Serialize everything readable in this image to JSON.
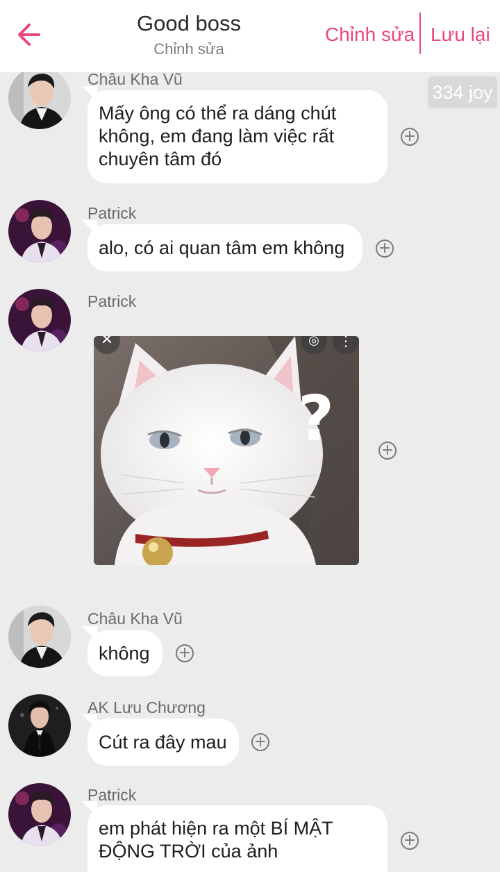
{
  "header": {
    "title": "Good boss",
    "subtitle": "Chỉnh sửa",
    "edit_label": "Chỉnh sửa",
    "save_label": "Lưu lại"
  },
  "badge": {
    "label": "334 joy"
  },
  "icons": {
    "back": "arrow-left-icon",
    "add": "plus-circle-icon",
    "close": "close-icon",
    "scan": "lens-icon",
    "more": "more-vertical-icon"
  },
  "colors": {
    "accent": "#e8467e",
    "background": "#ececec",
    "bubble": "#ffffff"
  },
  "messages": [
    {
      "sender": "Châu Kha Vũ",
      "text": "Mấy ông có thể ra dáng chút\nkhông, em đang làm việc rất\nchuyên tâm đó"
    },
    {
      "sender": "Patrick",
      "text": "alo, có ai quan tâm em không"
    },
    {
      "sender": "Patrick",
      "image": "white-cat-question-mark-meme"
    },
    {
      "sender": "Châu Kha Vũ",
      "text": "không"
    },
    {
      "sender": "AK Lưu Chương",
      "text": "Cút ra đây mau"
    },
    {
      "sender": "Patrick",
      "text": "em phát hiện ra một BÍ MẬT\nĐỘNG TRỜI của ảnh"
    }
  ]
}
